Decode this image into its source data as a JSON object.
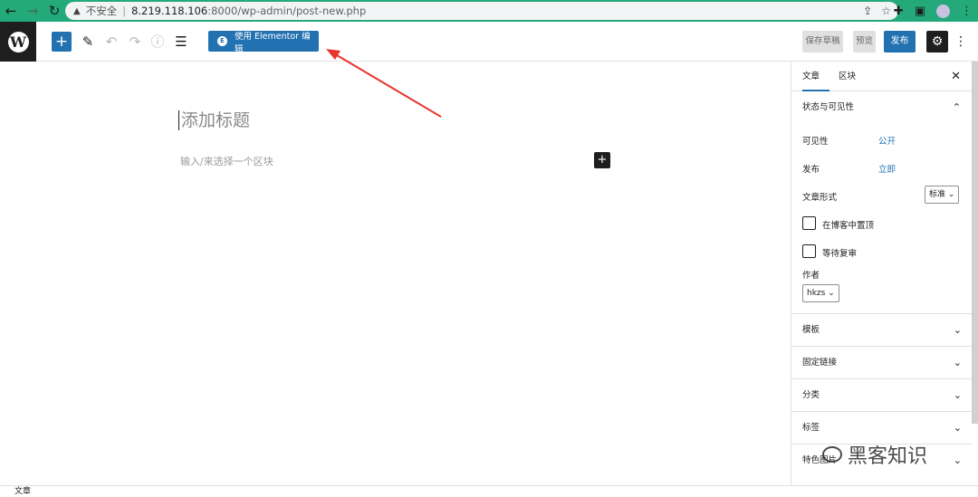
{
  "browser": {
    "insecure_label": "不安全",
    "url_host": "8.219.118.106",
    "url_path": ":8000/wp-admin/post-new.php"
  },
  "header": {
    "elementor_button": "使用 Elementor 编辑",
    "save_draft": "保存草稿",
    "preview": "预览",
    "publish": "发布"
  },
  "canvas": {
    "title_placeholder": "添加标题",
    "block_placeholder": "输入/来选择一个区块"
  },
  "sidebar": {
    "tabs": [
      "文章",
      "区块"
    ],
    "status_panel": "状态与可见性",
    "visibility_label": "可见性",
    "visibility_value": "公开",
    "publish_label": "发布",
    "publish_value": "立即",
    "format_label": "文章形式",
    "format_value": "标准",
    "sticky_label": "在博客中置顶",
    "pending_label": "等待复审",
    "author_label": "作者",
    "author_value": "hkzs",
    "collapsed_panels": [
      "模板",
      "固定链接",
      "分类",
      "标签",
      "特色图片"
    ]
  },
  "footer": {
    "breadcrumb": "文章"
  },
  "watermark": "黑客知识",
  "colors": {
    "accent": "#2271b1",
    "browser_bar": "#23a97a",
    "arrow": "#e8352e"
  }
}
